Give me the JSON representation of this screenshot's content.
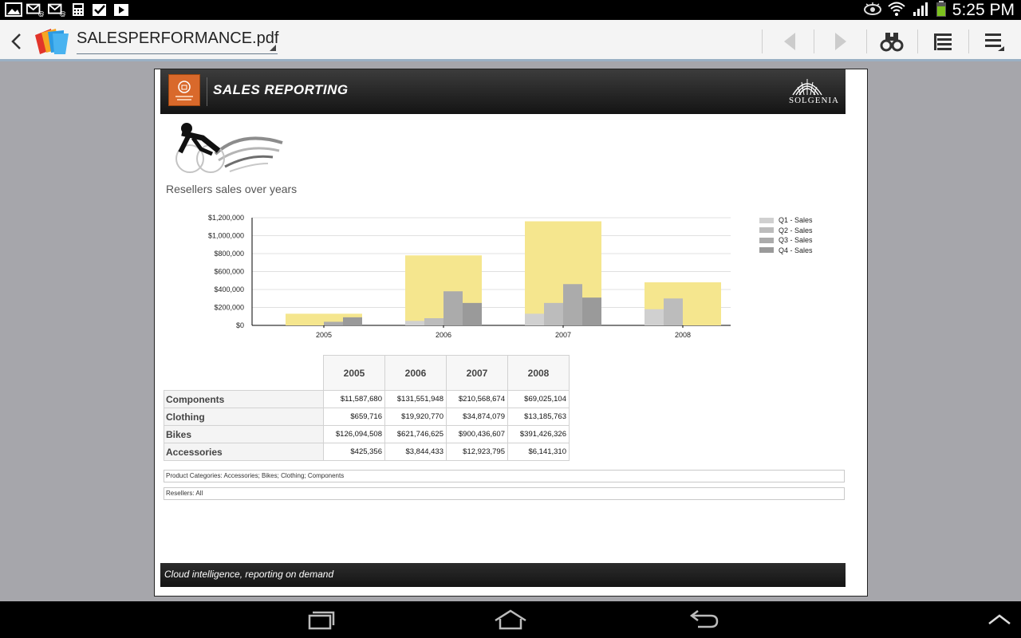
{
  "status_bar": {
    "time": "5:25 PM",
    "left_icons": [
      "gallery-icon",
      "mail-at-icon",
      "mail-at-icon",
      "calculator-icon",
      "checkbox-icon",
      "play-store-icon"
    ],
    "right_icons": [
      "eye-icon",
      "wifi-icon",
      "signal-icon",
      "battery-icon"
    ]
  },
  "toolbar": {
    "document_title": "SALESPERFORMANCE.pdf",
    "icons": [
      "back-arrow-icon",
      "polaris-logo-icon",
      "previous-icon",
      "next-icon",
      "binoculars-search-icon",
      "outline-list-icon",
      "menu-icon"
    ]
  },
  "report": {
    "header_title": "SALES REPORTING",
    "brand": "SOLGENIA",
    "chart_heading": "Resellers sales over years",
    "footer": "Cloud intelligence, reporting on demand",
    "filters": [
      "Product Categories: Accessories; Bikes; Clothing; Components",
      "Resellers: All"
    ]
  },
  "chart_data": {
    "type": "bar",
    "categories": [
      "2005",
      "2006",
      "2007",
      "2008"
    ],
    "yticks": [
      "$1,200,000",
      "$1,000,000",
      "$800,000",
      "$600,000",
      "$400,000",
      "$200,000",
      "$0"
    ],
    "ylim": [
      0,
      1200000
    ],
    "total_values": [
      130000,
      780000,
      1160000,
      480000
    ],
    "series": [
      {
        "name": "Q1 - Sales",
        "values": [
          0,
          50000,
          130000,
          180000
        ],
        "color": "#d0d0d0"
      },
      {
        "name": "Q2 - Sales",
        "values": [
          0,
          80000,
          250000,
          300000
        ],
        "color": "#bcbcbc"
      },
      {
        "name": "Q3 - Sales",
        "values": [
          40000,
          380000,
          460000,
          0
        ],
        "color": "#ababab"
      },
      {
        "name": "Q4 - Sales",
        "values": [
          90000,
          250000,
          310000,
          0
        ],
        "color": "#9a9a9a"
      }
    ],
    "total_color": "#f5e68e",
    "grid": true,
    "legend": "right"
  },
  "table": {
    "columns": [
      "2005",
      "2006",
      "2007",
      "2008"
    ],
    "rows": [
      {
        "label": "Components",
        "values": [
          "$11,587,680",
          "$131,551,948",
          "$210,568,674",
          "$69,025,104"
        ]
      },
      {
        "label": "Clothing",
        "values": [
          "$659,716",
          "$19,920,770",
          "$34,874,079",
          "$13,185,763"
        ]
      },
      {
        "label": "Bikes",
        "values": [
          "$126,094,508",
          "$621,746,625",
          "$900,436,607",
          "$391,426,326"
        ]
      },
      {
        "label": "Accessories",
        "values": [
          "$425,356",
          "$3,844,433",
          "$12,923,795",
          "$6,141,310"
        ]
      }
    ]
  },
  "nav_bar": {
    "icons": [
      "recent-apps-icon",
      "home-icon",
      "back-icon",
      "chevron-up-icon"
    ]
  }
}
